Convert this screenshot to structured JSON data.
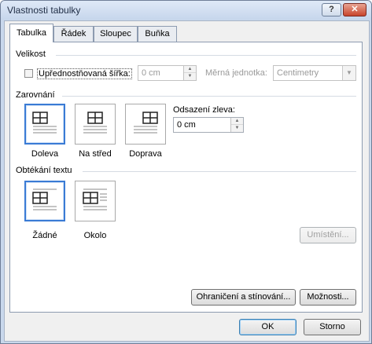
{
  "window": {
    "title": "Vlastnosti tabulky",
    "help_glyph": "?",
    "close_glyph": "✕",
    "accent_color": "#3a7bd5"
  },
  "tabs": [
    {
      "label": "Tabulka",
      "active": true
    },
    {
      "label": "Řádek",
      "active": false
    },
    {
      "label": "Sloupec",
      "active": false
    },
    {
      "label": "Buňka",
      "active": false
    }
  ],
  "size_section": {
    "heading": "Velikost",
    "preferred_width_label": "Upřednostňovaná šířka:",
    "preferred_width_checked": false,
    "width_value": "0 cm",
    "unit_label": "Měrná jednotka:",
    "unit_value": "Centimetry"
  },
  "alignment_section": {
    "heading": "Zarovnání",
    "options": [
      {
        "label": "Doleva",
        "selected": true
      },
      {
        "label": "Na střed",
        "selected": false
      },
      {
        "label": "Doprava",
        "selected": false
      }
    ],
    "indent_label": "Odsazení zleva:",
    "indent_value": "0 cm"
  },
  "wrap_section": {
    "heading": "Obtékání textu",
    "options": [
      {
        "label": "Žádné",
        "selected": true
      },
      {
        "label": "Okolo",
        "selected": false
      }
    ],
    "positioning_button": "Umístění..."
  },
  "buttons": {
    "borders": "Ohraničení a stínování...",
    "options": "Možnosti...",
    "ok": "OK",
    "cancel": "Storno"
  }
}
